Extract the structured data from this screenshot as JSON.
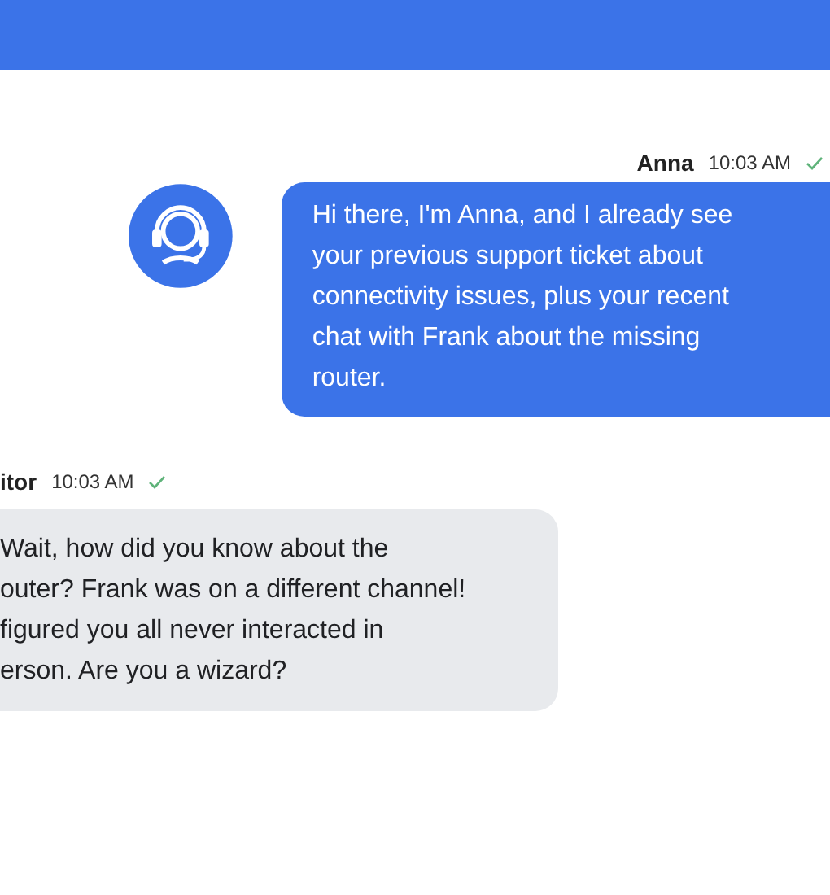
{
  "header_bar": {
    "kind": "bar"
  },
  "messages": [
    {
      "kind": "agent",
      "sender": "Anna",
      "time": "10:03 AM",
      "delivered": true,
      "lines": [
        "Hi there, I'm Anna, and I already see",
        "your previous support ticket about",
        "connectivity issues, plus your recent",
        "chat with Frank about the missing",
        "router."
      ]
    },
    {
      "kind": "visitor",
      "sender": "itor",
      "time": "10:03 AM",
      "delivered": true,
      "lines": [
        "Wait, how did you know about the",
        "outer? Frank was on a different channel!",
        "figured you all never interacted in",
        "erson. Are you a wizard?"
      ]
    }
  ]
}
